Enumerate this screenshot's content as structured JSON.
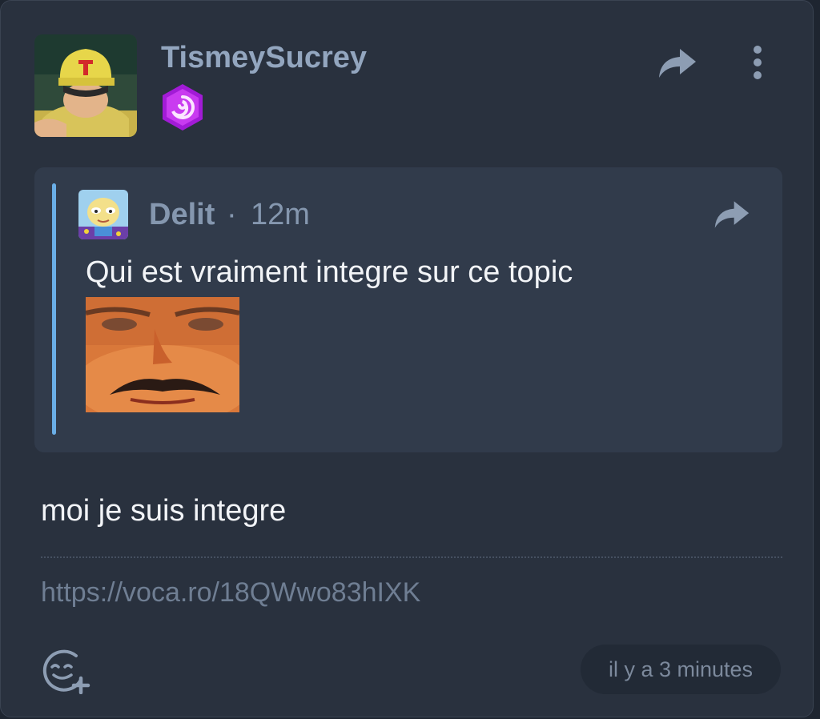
{
  "post": {
    "username": "TismeySucrey",
    "avatar_icon": "baseball-cap-character-avatar",
    "badge_icon": "purple-swirl-hexagon-badge",
    "share_icon": "share-arrow-icon",
    "menu_icon": "vertical-dots-icon",
    "text": "moi je suis integre",
    "link": "https://voca.ro/18QWwo83hIXK",
    "react_icon": "add-reaction-icon",
    "timestamp": "il y a 3 minutes"
  },
  "quote": {
    "author": "Delit",
    "separator": "·",
    "time": "12m",
    "avatar_icon": "cartoon-baby-avatar",
    "share_icon": "share-arrow-icon",
    "text": "Qui est vraiment integre sur ce topic",
    "image_icon": "laughing-face-sticker"
  },
  "colors": {
    "card_bg": "#29313e",
    "quote_bg": "#313b4b",
    "quote_accent": "#6aaee6",
    "muted_text": "#93a6bf",
    "body_text": "#f2f4f7"
  }
}
